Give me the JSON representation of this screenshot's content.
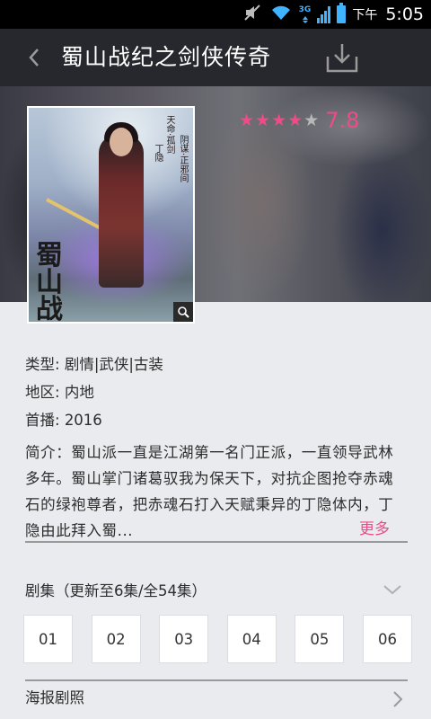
{
  "status_bar": {
    "ampm": "下午",
    "time": "5:05",
    "network": "3G",
    "colors": {
      "accent": "#3fb3ff"
    },
    "icons": [
      "mute-icon",
      "wifi-icon",
      "signal-icon",
      "battery-icon"
    ]
  },
  "header": {
    "title": "蜀山战纪之剑侠传奇",
    "back_icon": "back-chevron-icon",
    "download_icon": "download-icon"
  },
  "rating": {
    "stars_filled": 4,
    "stars_total": 5,
    "score": "7.8",
    "colors": {
      "filled": "#ef4b86",
      "empty": "#b8b8b8"
    }
  },
  "info": {
    "genre_label": "类型:",
    "genre_value": "剧情|武侠|古装",
    "region_label": "地区:",
    "region_value": "内地",
    "premiere_label": "首播:",
    "premiere_value": "2016",
    "synopsis": "简介：蜀山派一直是江湖第一名门正派，一直领导武林多年。蜀山掌门诸葛驭我为保天下，对抗企图抢夺赤魂石的绿袍尊者，把赤魂石打入天赋秉异的丁隐体内，丁隐由此拜入蜀...",
    "more": "更多"
  },
  "episodes": {
    "header": "剧集（更新至6集/全54集）",
    "items": [
      "01",
      "02",
      "03",
      "04",
      "05",
      "06"
    ]
  },
  "posters": {
    "label": "海报剧照"
  },
  "poster_art": {
    "calligraphy": "蜀山战纪",
    "vertical_text_1": "天命·孤剑",
    "vertical_text_2": "丁隐",
    "vertical_text_3": "阴谋·正邪间"
  }
}
